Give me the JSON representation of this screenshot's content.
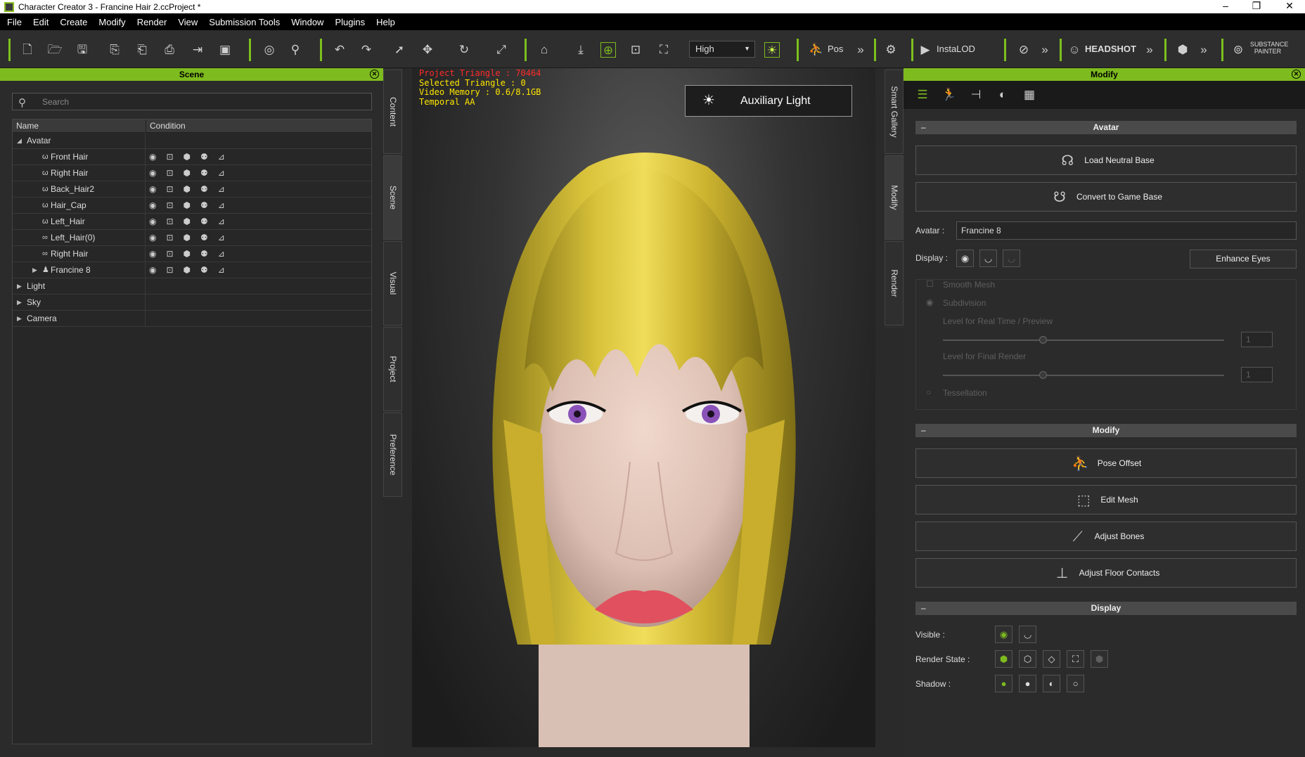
{
  "window": {
    "title": "Character Creator 3 - Francine Hair 2.ccProject *",
    "min": "–",
    "max": "❐",
    "close": "✕"
  },
  "menu": [
    "File",
    "Edit",
    "Create",
    "Modify",
    "Render",
    "View",
    "Submission Tools",
    "Window",
    "Plugins",
    "Help"
  ],
  "toolbar": {
    "quality": "High",
    "pos_label": "Pos",
    "instalod": "InstaLOD",
    "headshot": "HEADSHOT",
    "substance": "SUBSTANCE PAINTER"
  },
  "scene": {
    "title": "Scene",
    "search_placeholder": "Search",
    "col_name": "Name",
    "col_condition": "Condition",
    "items": [
      {
        "label": "Avatar",
        "indent": 0,
        "arrow": "◢",
        "icon": ""
      },
      {
        "label": "Front Hair",
        "indent": 1,
        "arrow": "",
        "icon": "ω"
      },
      {
        "label": "Right Hair",
        "indent": 1,
        "arrow": "",
        "icon": "ω"
      },
      {
        "label": "Back_Hair2",
        "indent": 1,
        "arrow": "",
        "icon": "ω"
      },
      {
        "label": "Hair_Cap",
        "indent": 1,
        "arrow": "",
        "icon": "ω"
      },
      {
        "label": "Left_Hair",
        "indent": 1,
        "arrow": "",
        "icon": "ω"
      },
      {
        "label": "Left_Hair(0)",
        "indent": 1,
        "arrow": "",
        "icon": "∞"
      },
      {
        "label": "Right Hair",
        "indent": 1,
        "arrow": "",
        "icon": "∞"
      },
      {
        "label": "Francine 8",
        "indent": 1,
        "arrow": "▶",
        "icon": "♟"
      },
      {
        "label": "Light",
        "indent": 0,
        "arrow": "▶",
        "icon": ""
      },
      {
        "label": "Sky",
        "indent": 0,
        "arrow": "▶",
        "icon": ""
      },
      {
        "label": "Camera",
        "indent": 0,
        "arrow": "▶",
        "icon": ""
      }
    ]
  },
  "left_tabs": [
    "Content",
    "Scene",
    "Visual",
    "Project",
    "Preference"
  ],
  "right_tabs": [
    "Smart Gallery",
    "Modify",
    "Render"
  ],
  "viewport": {
    "hud": [
      "Project Triangle : 70464",
      "Selected Triangle : 0",
      "Video Memory : 0.6/8.1GB",
      "Temporal AA"
    ],
    "aux_light": "Auxiliary Light"
  },
  "modify": {
    "title": "Modify",
    "avatar_section": "Avatar",
    "load_neutral": "Load Neutral Base",
    "convert_game": "Convert to Game Base",
    "avatar_label": "Avatar :",
    "avatar_value": "Francine 8",
    "display_label": "Display :",
    "enhance_eyes": "Enhance Eyes",
    "smooth_mesh": "Smooth Mesh",
    "subdivision": "Subdivision",
    "level_realtime": "Level for Real Time / Preview",
    "level_final": "Level for Final Render",
    "level_value": "1",
    "tessellation": "Tessellation",
    "modify_section": "Modify",
    "pose_offset": "Pose Offset",
    "edit_mesh": "Edit Mesh",
    "adjust_bones": "Adjust Bones",
    "adjust_floor": "Adjust Floor Contacts",
    "display_section": "Display",
    "visible_label": "Visible :",
    "render_state_label": "Render State :",
    "shadow_label": "Shadow :"
  },
  "colors": {
    "accent": "#7dbb1e",
    "hud_red": "#ff2a2a",
    "hud_yellow": "#ffe600"
  }
}
